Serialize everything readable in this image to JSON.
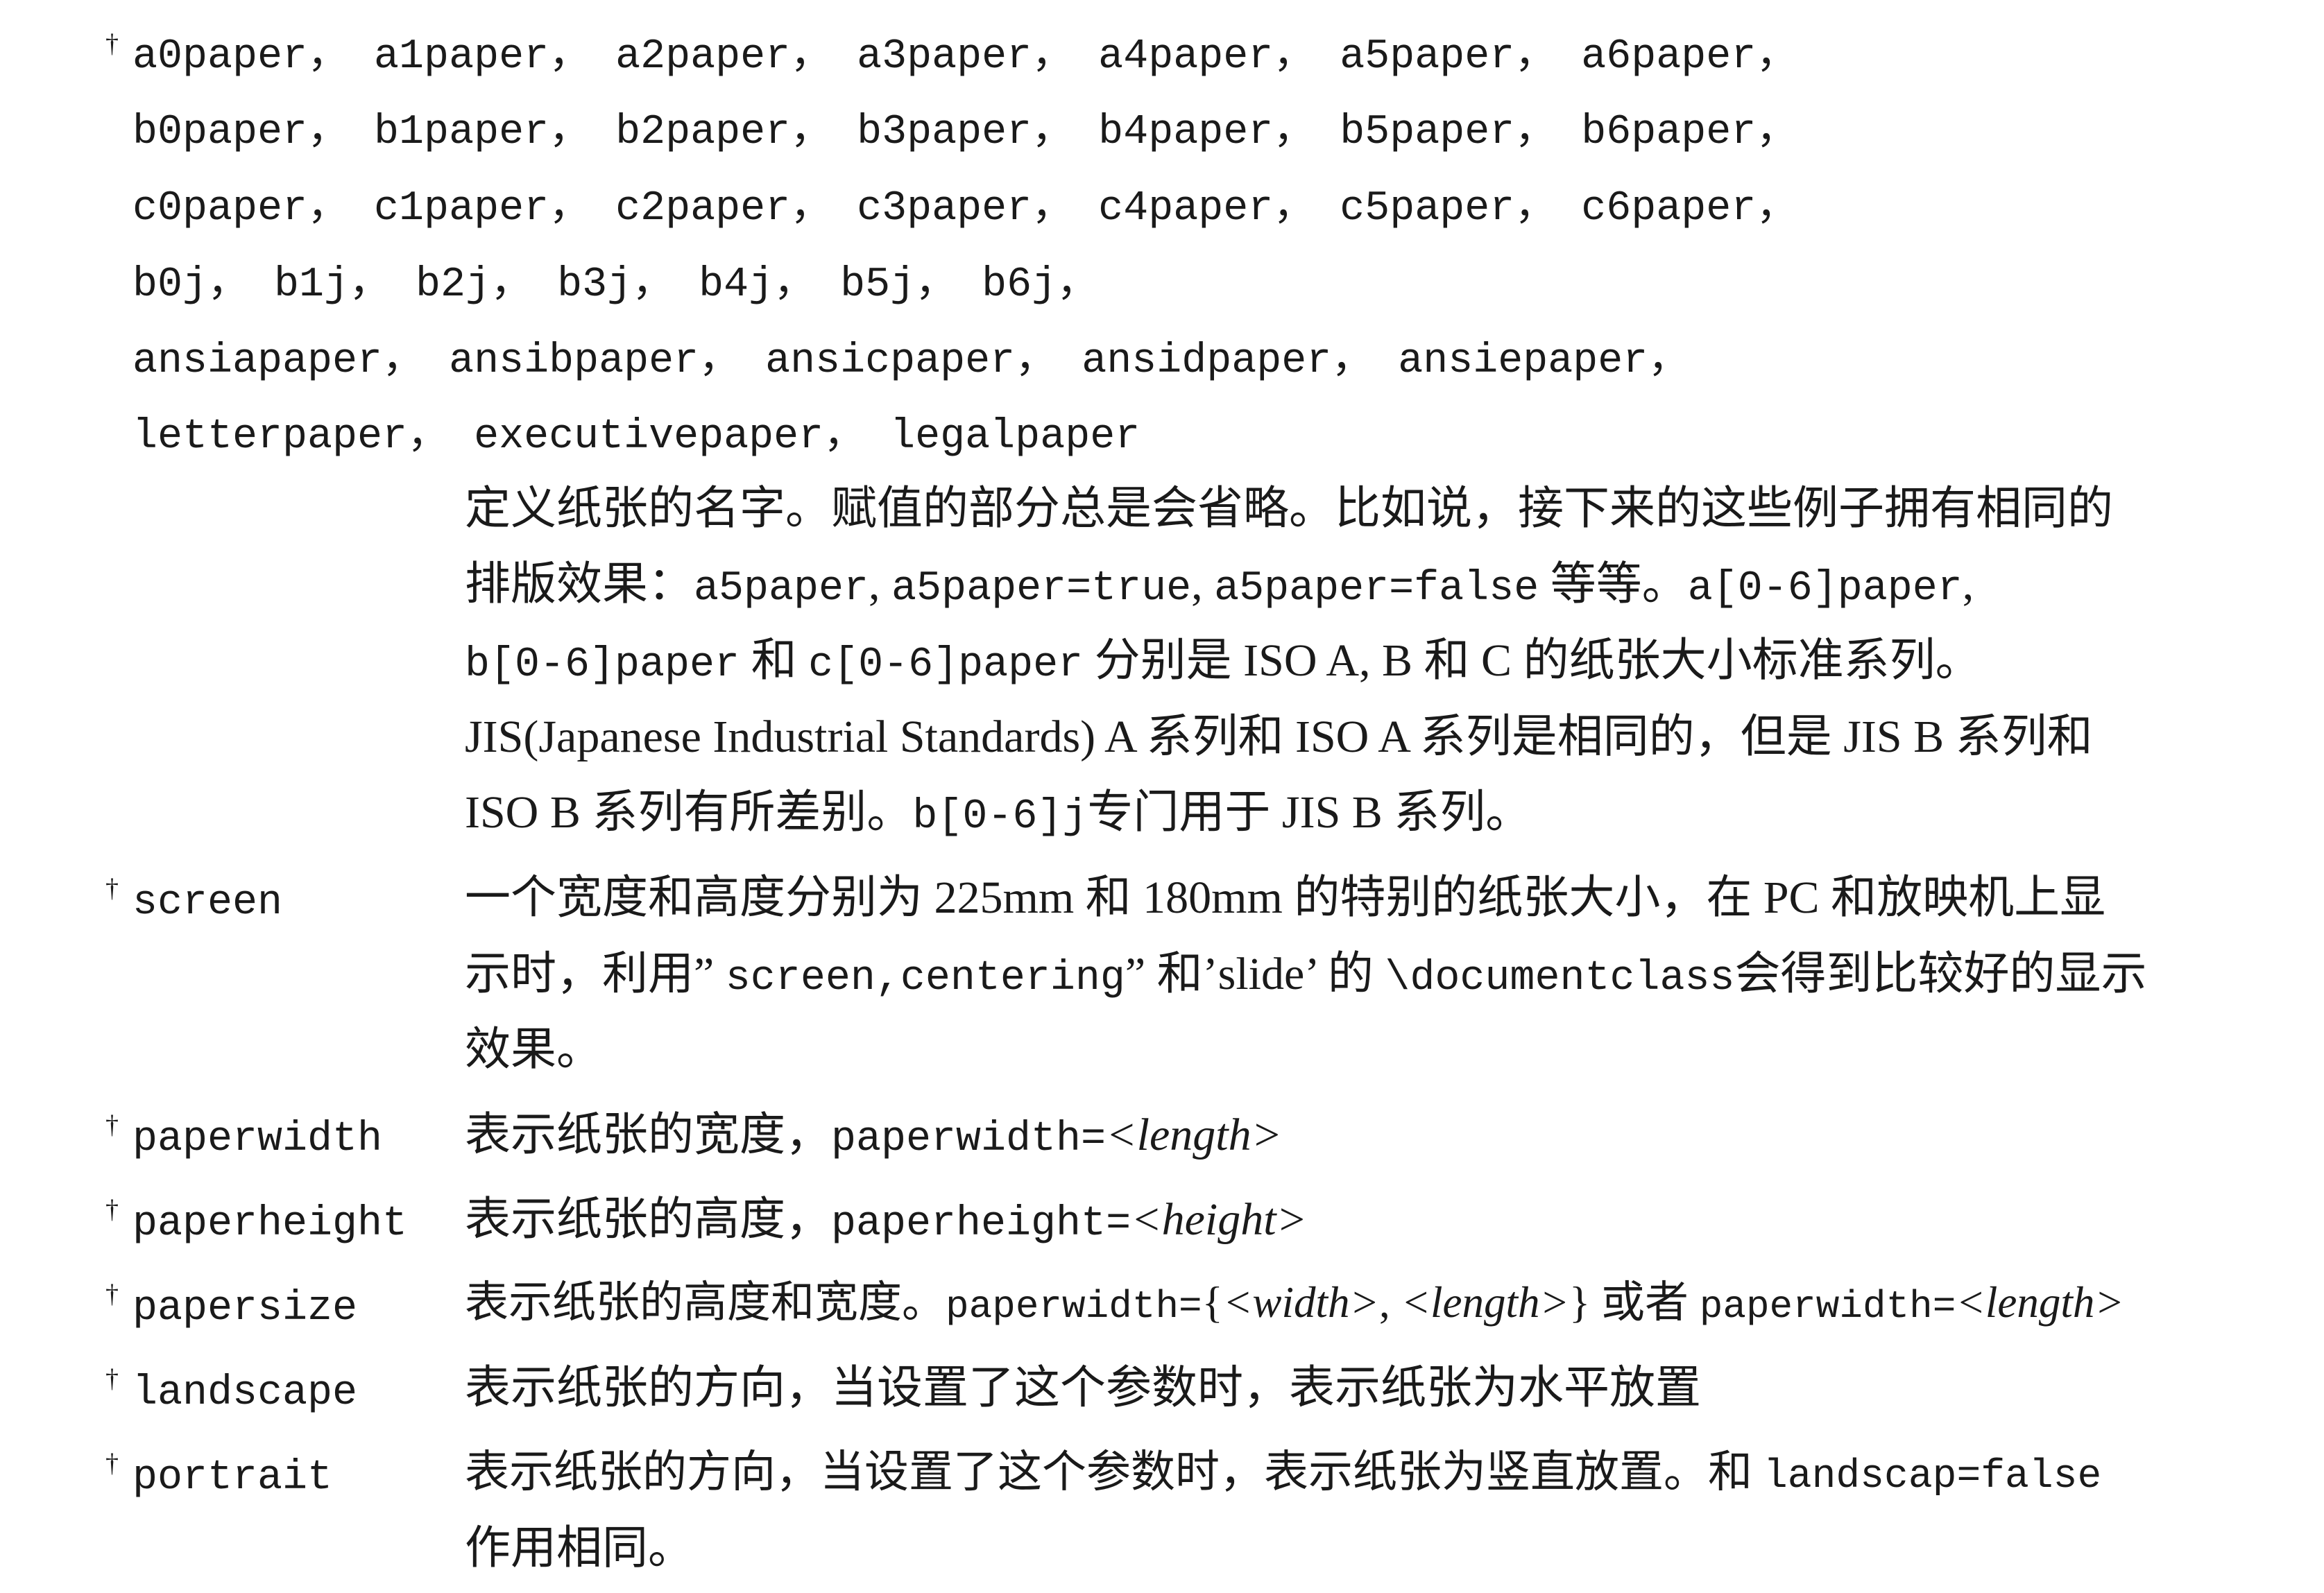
{
  "paper_names": {
    "lines": [
      "a0paper， a1paper， a2paper， a3paper， a4paper， a5paper， a6paper，",
      "b0paper， b1paper， b2paper， b3paper， b4paper， b5paper， b6paper，",
      "c0paper， c1paper， c2paper， c3paper， c4paper， c5paper， c6paper，",
      "b0j， b1j， b2j， b3j， b4j， b5j， b6j，",
      "ansiapaper， ansibpaper， ansicpaper， ansidpaper， ansiepaper，",
      "letterpaper， executivepaper， legalpaper"
    ],
    "desc": {
      "l1": "定义纸张的名字。赋值的部分总是会省略。比如说，接下来的这些例子拥有相同的",
      "l2_a": "排版效果：",
      "l2_c1": "a5paper",
      "l2_s1": ", ",
      "l2_c2": "a5paper=true",
      "l2_s2": ", ",
      "l2_c3": "a5paper=false",
      "l2_b": " 等等。",
      "l2_c4": "a[0-6]paper",
      "l2_end": ",",
      "l3_c1": "b[0-6]paper",
      "l3_a": " 和 ",
      "l3_c2": "c[0-6]paper",
      "l3_b": " 分别是 ISO A, B 和 C 的纸张大小标准系列。",
      "l4": "JIS(Japanese Industrial Standards) A 系列和 ISO A 系列是相同的，但是 JIS B 系列和",
      "l5_a": "ISO B 系列有所差别。",
      "l5_c": "b[0-6]j",
      "l5_b": "专门用于 JIS B 系列。"
    }
  },
  "options": {
    "dagger": "†",
    "screen": {
      "term": "screen",
      "l1": "一个宽度和高度分别为 225mm 和 180mm 的特别的纸张大小，在 PC 和放映机上显",
      "l2_a": "示时，利用” ",
      "l2_c1": "screen,centering",
      "l2_b": "” 和’slide’ 的 ",
      "l2_c2": "\\documentclass",
      "l2_c": "会得到比较好的显示",
      "l3": "效果。"
    },
    "paperwidth": {
      "term": "paperwidth",
      "a": "表示纸张的宽度，",
      "c": "paperwidth=",
      "arg": "<length>"
    },
    "paperheight": {
      "term": "paperheight",
      "a": "表示纸张的高度，",
      "c": "paperheight=",
      "arg": "<height>"
    },
    "papersize": {
      "term": "papersize",
      "a": "表示纸张的高度和宽度。",
      "c1": "paperwidth=",
      "p1": "{",
      "arg1": "<width>",
      "p2": ", ",
      "arg2": "<length>",
      "p3": "} 或者 ",
      "c2": "paperwidth=",
      "arg3": "<length>"
    },
    "landscape": {
      "term": "landscape",
      "a": "表示纸张的方向，当设置了这个参数时，表示纸张为水平放置"
    },
    "portrait": {
      "term": "portrait",
      "l1_a": "表示纸张的方向，当设置了这个参数时，表示纸张为竖直放置。和 ",
      "l1_c": "landscap=false",
      "l2": "作用相同。"
    }
  }
}
